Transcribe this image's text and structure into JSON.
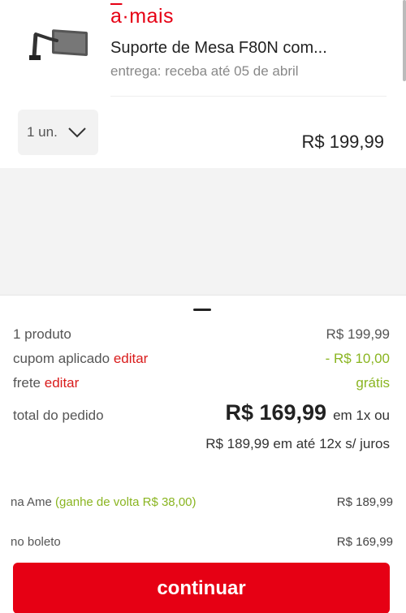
{
  "brand": {
    "prefix": "a",
    "separator": "·",
    "name": "mais"
  },
  "product": {
    "title": "Suporte de Mesa F80N com...",
    "delivery": "entrega: receba até 05 de abril",
    "quantity_label": "1 un.",
    "price": "R$ 199,99",
    "image_icon": "monitor-arm-icon"
  },
  "summary": {
    "products_label": "1 produto",
    "products_value": "R$ 199,99",
    "coupon_label": "cupom aplicado",
    "coupon_edit": "editar",
    "coupon_value": "- R$ 10,00",
    "shipping_label": "frete",
    "shipping_edit": "editar",
    "shipping_value": "grátis",
    "total_label": "total do pedido",
    "total_value": "R$ 169,99",
    "total_suffix": "em 1x ou",
    "installments": "R$ 189,99 em até 12x s/ juros"
  },
  "payment_options": [
    {
      "label": "na Ame",
      "bonus": "(ganhe de volta R$ 38,00)",
      "value": "R$ 189,99"
    },
    {
      "label": "no boleto",
      "bonus": "",
      "value": "R$ 169,99"
    }
  ],
  "continue_label": "continuar",
  "colors": {
    "brand_red": "#e60014",
    "green": "#8ab521",
    "edit_red": "#d91b1b"
  }
}
